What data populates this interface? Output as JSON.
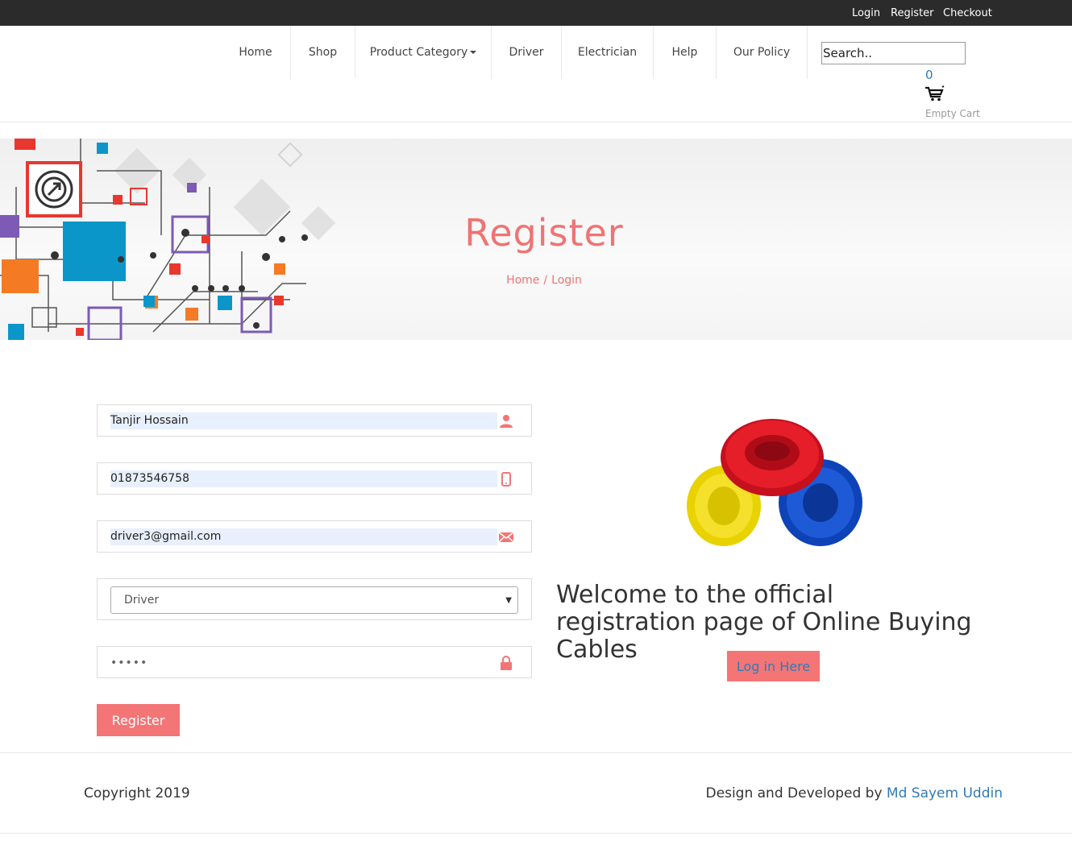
{
  "topbar": {
    "login": "Login",
    "register": "Register",
    "checkout": "Checkout"
  },
  "nav": {
    "items": [
      "Home",
      "Shop",
      "Product Category",
      "Driver",
      "Electrician",
      "Help",
      "Our Policy"
    ],
    "search_placeholder": "Search..",
    "cart_count": "0",
    "cart_label": "Empty Cart"
  },
  "banner": {
    "title": "Register",
    "crumbs": [
      "Home",
      "Login"
    ]
  },
  "form": {
    "name": "Tanjir Hossain",
    "phone": "01873546758",
    "email": "driver3@gmail.com",
    "role": "Driver",
    "password_mask": "•••••",
    "submit": "Register"
  },
  "right": {
    "welcome": "Welcome to the official registration page of Online Buying Cables",
    "login_button": "Log in Here"
  },
  "footer": {
    "copyright": "Copyright 2019",
    "credit_prefix": "Design and Developed by",
    "author": "Md Sayem Uddin"
  },
  "colors": {
    "accent": "#f37575",
    "link": "#337ab7",
    "topbar": "#2b2b2b"
  }
}
